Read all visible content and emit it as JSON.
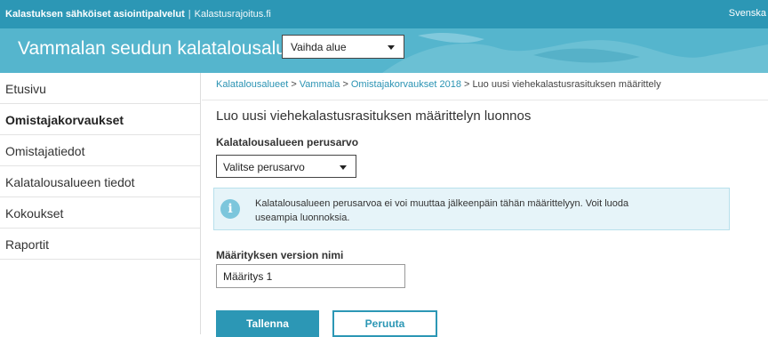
{
  "topbar": {
    "brand": "Kalastuksen sähköiset asiointipalvelut",
    "separator": "|",
    "site": "Kalastusrajoitus.fi",
    "language_link": "Svenska"
  },
  "header": {
    "title": "Vammalan seudun kalatalousalue",
    "area_select": "Vaihda alue"
  },
  "sidebar": {
    "items": [
      {
        "label": "Etusivu"
      },
      {
        "label": "Omistajakorvaukset"
      },
      {
        "label": "Omistajatiedot"
      },
      {
        "label": "Kalatalousalueen tiedot"
      },
      {
        "label": "Kokoukset"
      },
      {
        "label": "Raportit"
      }
    ]
  },
  "breadcrumb": {
    "items": [
      "Kalatalousalueet",
      "Vammala",
      "Omistajakorvaukset 2018"
    ],
    "separator": ">",
    "current": "Luo uusi viehekalastusrasituksen määrittely"
  },
  "main": {
    "title": "Luo uusi viehekalastusrasituksen määrittelyn luonnos",
    "base_value_label": "Kalatalousalueen perusarvo",
    "base_value_select": "Valitse perusarvo",
    "info_text": "Kalatalousalueen perusarvoa ei voi muuttaa jälkeenpäin tähän määrittelyyn. Voit luoda useampia luonnoksia.",
    "version_name_label": "Määrityksen version nimi",
    "version_name_value": "Määritys 1",
    "save_button": "Tallenna",
    "cancel_button": "Peruuta"
  },
  "icons": {
    "info": "info-icon",
    "dropdown": "chevron-down-icon"
  },
  "colors": {
    "topbar": "#2c97b5",
    "header": "#55b5cd",
    "accent": "#2c97b5",
    "link": "#2a93b3",
    "info_bg": "#e6f4f9"
  }
}
